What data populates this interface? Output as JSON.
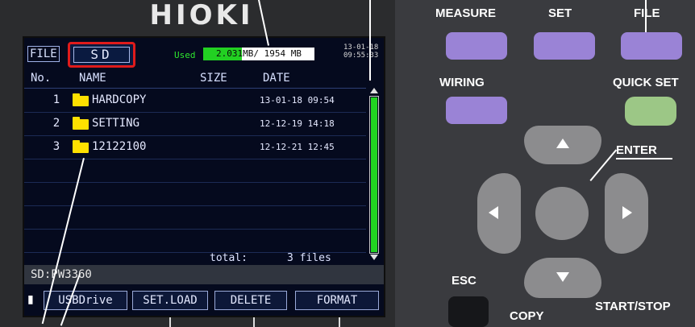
{
  "brand": "HIOKI",
  "screen": {
    "mode_label": "FILE",
    "tab_label": "SD",
    "used_label": "Used",
    "used_value": "2.031MB/ 1954 MB",
    "clock_date": "13-01-18",
    "clock_time": "09:55:33",
    "columns": [
      "No.",
      "NAME",
      "SIZE",
      "DATE"
    ],
    "rows": [
      {
        "no": "1",
        "name": "HARDCOPY",
        "date": "13-01-18 09:54",
        "icon": "folder-icon"
      },
      {
        "no": "2",
        "name": "SETTING",
        "date": "12-12-19 14:18",
        "icon": "folder-icon"
      },
      {
        "no": "3",
        "name": "12122100",
        "date": "12-12-21 12:45",
        "icon": "folder-icon"
      }
    ],
    "total_label": "total:",
    "total_value": "3 files",
    "path": "SD:PW3360",
    "function_keys": [
      "USBDrive",
      "SET.LOAD",
      "DELETE",
      "FORMAT"
    ]
  },
  "panel": {
    "measure_label": "MEASURE",
    "set_label": "SET",
    "file_label": "FILE",
    "wiring_label": "WIRING",
    "quickset_label": "QUICK SET",
    "enter_label": "ENTER",
    "esc_label": "ESC",
    "copy_label": "COPY",
    "startstop_label": "START/STOP"
  },
  "colors": {
    "screen_bg": "#050a1e",
    "highlight_red": "#e01b1b",
    "bar_green": "#22d022",
    "key_purple": "#9a83d6",
    "key_green": "#9cc786"
  },
  "storage_used_fraction": 0.35
}
